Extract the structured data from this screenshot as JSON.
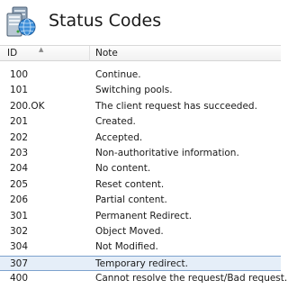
{
  "header": {
    "title": "Status Codes",
    "icon": "server-icon"
  },
  "columns": {
    "id": "ID",
    "note": "Note"
  },
  "rows": [
    {
      "id": "100",
      "note": "Continue."
    },
    {
      "id": "101",
      "note": "Switching pools."
    },
    {
      "id": "200.OK",
      "note": "The client request has succeeded."
    },
    {
      "id": "201",
      "note": "Created."
    },
    {
      "id": "202",
      "note": "Accepted."
    },
    {
      "id": "203",
      "note": "Non-authoritative information."
    },
    {
      "id": "204",
      "note": "No content."
    },
    {
      "id": "205",
      "note": "Reset content."
    },
    {
      "id": "206",
      "note": "Partial content."
    },
    {
      "id": "301",
      "note": "Permanent Redirect."
    },
    {
      "id": "302",
      "note": "Object Moved."
    },
    {
      "id": "304",
      "note": "Not Modified."
    },
    {
      "id": "307",
      "note": "Temporary redirect."
    },
    {
      "id": "400",
      "note": "Cannot resolve the request/Bad request."
    }
  ],
  "selected_row": 12
}
